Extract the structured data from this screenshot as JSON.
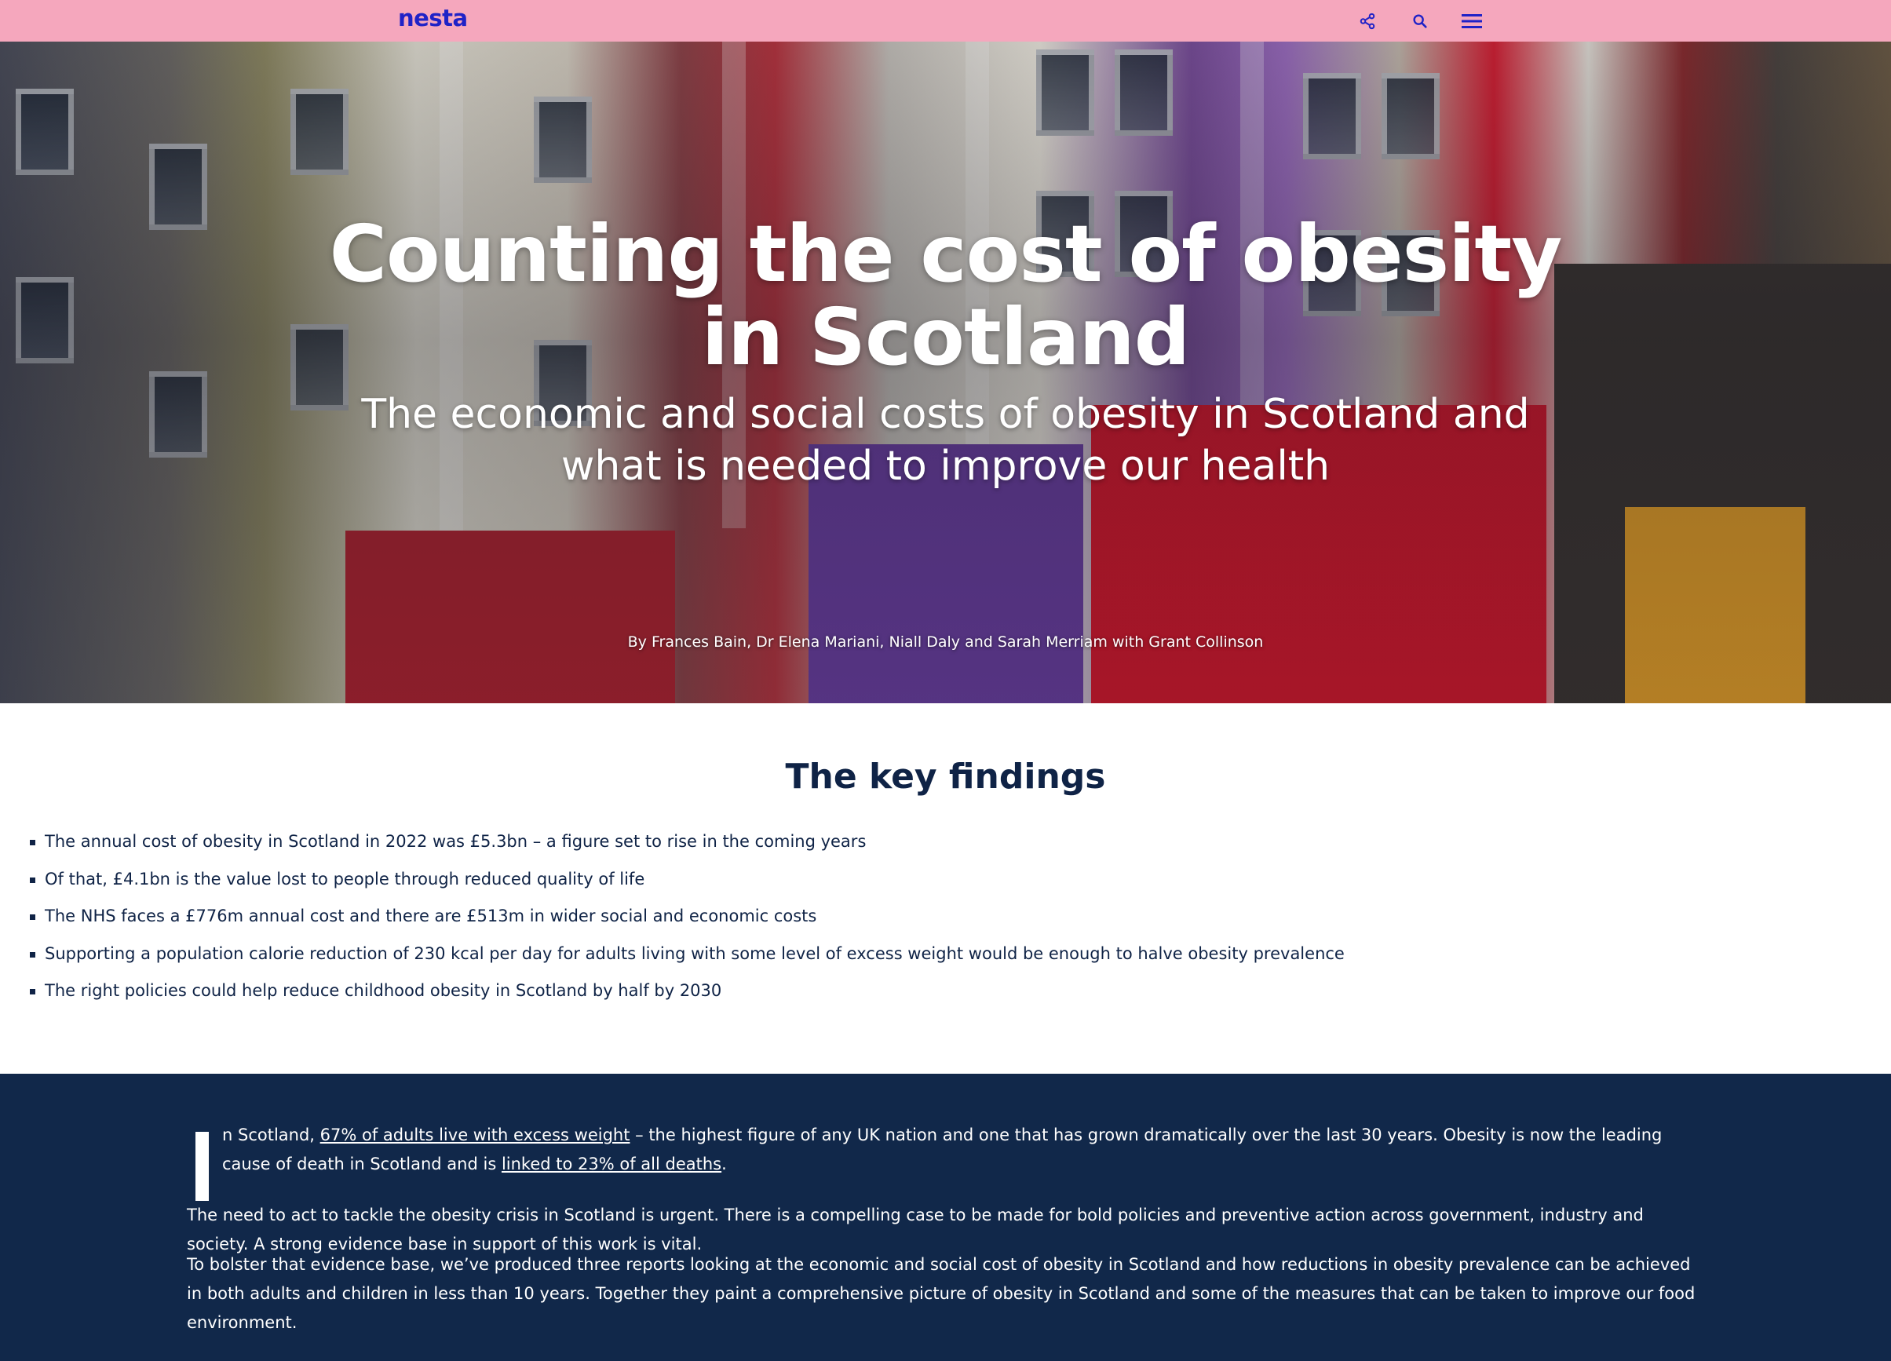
{
  "header": {
    "logo": "nesta",
    "share_icon": "share-icon",
    "search_icon": "search-icon",
    "menu_icon": "menu-icon",
    "accent_color": "#f5a7bd",
    "logo_color": "#1f22c7"
  },
  "hero": {
    "title_line1": "Counting the cost of obesity",
    "title_line2": "in Scotland",
    "subtitle_line1": "The economic and social costs of obesity in Scotland and",
    "subtitle_line2": "what is needed to improve our health",
    "byline": "By Frances Bain, Dr Elena Mariani, Niall Daly and Sarah Merriam with Grant Collinson"
  },
  "findings": {
    "heading": "The key findings",
    "items": [
      "The annual cost of obesity in Scotland in 2022 was £5.3bn – a figure set to rise in the coming years",
      "Of that, £4.1bn is the value lost to people through reduced quality of life",
      "The NHS faces a £776m annual cost and there are £513m in wider social and economic costs",
      "Supporting a population calorie reduction of 230 kcal per day for adults living with some level of excess weight would be enough to halve obesity prevalence",
      "The right policies could help reduce childhood obesity in Scotland by half by 2030"
    ]
  },
  "article": {
    "background_color": "#11284a",
    "p1_prefix": "n Scotland, ",
    "p1_link1": "67% of adults live with excess weight",
    "p1_mid": " – the highest figure of any UK nation and one that has grown dramatically over the last 30 years. Obesity is now the leading cause of death in Scotland and is ",
    "p1_link2": "linked to 23% of all deaths",
    "p1_suffix": ".",
    "p2": "The need to act to tackle the obesity crisis in Scotland is urgent. There is  a compelling case to be made for bold policies and preventive action across government, industry and society.  A strong evidence base in support of this work is vital.",
    "p3": "To bolster that evidence base, we’ve produced three reports looking at the economic and social cost of obesity in Scotland and how reductions in obesity prevalence can be achieved in both adults and children in less than 10 years. Together they paint a comprehensive picture of obesity in Scotland and some of the measures that can be taken to improve our food environment."
  }
}
